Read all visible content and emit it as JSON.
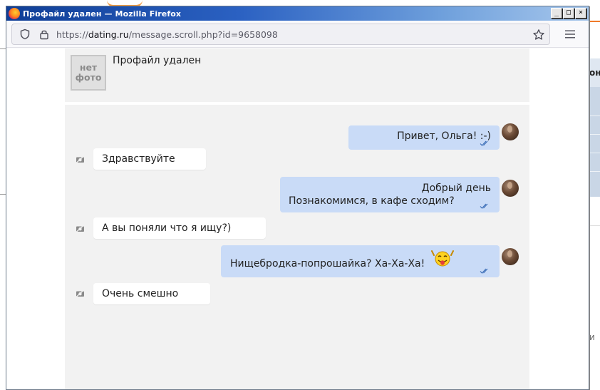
{
  "window": {
    "title": "Профайл удален — Mozilla Firefox",
    "controls": {
      "minimize": "_",
      "maximize": "□",
      "close": "×"
    }
  },
  "urlbar": {
    "prefix": "https://",
    "host": "dating.ru",
    "path": "/message.scroll.php?id=9658098"
  },
  "profile": {
    "no_photo_line1": "нет",
    "no_photo_line2": "фото",
    "name": "Профайл удален"
  },
  "messages": [
    {
      "from": "me",
      "text": "Привет, Ольга! :-)"
    },
    {
      "from": "them",
      "text": "Здравствуйте"
    },
    {
      "from": "me",
      "line1": "Добрый день",
      "line2": "Познакомимся, в кафе сходим?"
    },
    {
      "from": "them",
      "text": "А вы поняли что я ищу?)"
    },
    {
      "from": "me",
      "text": "Нищебродка-попрошайка? Ха-Ха-Ха!",
      "emoticon": "tongue-out-smiley-icon"
    },
    {
      "from": "them",
      "text": "Очень смешно"
    }
  ],
  "background": {
    "table_head_fragment": "онт",
    "text_fragment": "и"
  },
  "colors": {
    "outgoing_bubble": "#c9dbf7",
    "incoming_bubble": "#ffffff",
    "chat_background": "#f2f2f2",
    "titlebar": "#0f3e96"
  }
}
